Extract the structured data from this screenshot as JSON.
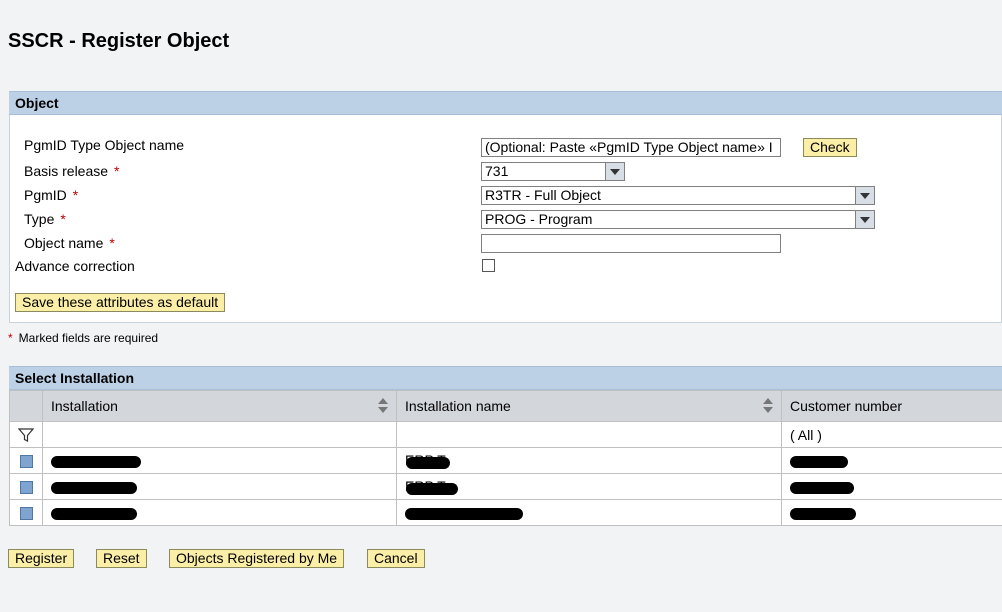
{
  "page": {
    "title": "SSCR - Register Object"
  },
  "object_section": {
    "header": "Object",
    "fields": {
      "pgmid_type_object_name": {
        "label": "PgmID Type Object name",
        "value": "(Optional: Paste «PgmID Type Object name»  I"
      },
      "basis_release": {
        "label": "Basis release",
        "value": "731"
      },
      "pgmid": {
        "label": "PgmID",
        "value": "R3TR - Full Object"
      },
      "type": {
        "label": "Type",
        "value": "PROG - Program"
      },
      "object_name": {
        "label": "Object name",
        "value": ""
      },
      "advance_correction": {
        "label": "Advance correction",
        "checked": false
      }
    },
    "required_mark": "*",
    "check_button": "Check",
    "save_defaults_button": "Save these attributes as default"
  },
  "required_note": "Marked fields are required",
  "installation_section": {
    "header": "Select Installation",
    "columns": [
      "Installation",
      "Installation name",
      "Customer number"
    ],
    "filter_customer": "( All )",
    "rows": [
      {
        "name_fragment": "ERP T"
      },
      {
        "name_fragment": "ERP T"
      },
      {
        "name_fragment": ""
      }
    ]
  },
  "footer_buttons": {
    "register": "Register",
    "reset": "Reset",
    "objects_registered": "Objects Registered by Me",
    "cancel": "Cancel"
  },
  "icons": {
    "filter": "funnel-icon",
    "sort": "sort-arrows-icon",
    "dropdown": "chevron-down-icon"
  }
}
